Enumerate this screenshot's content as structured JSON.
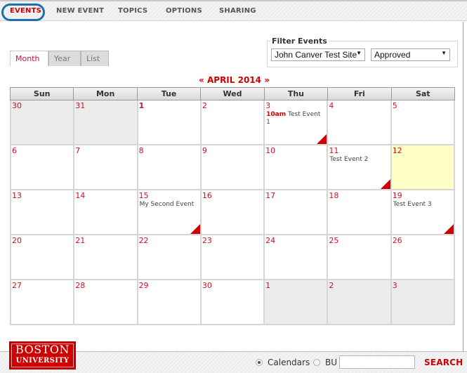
{
  "nav": {
    "items": [
      {
        "label": "EVENTS",
        "active": true
      },
      {
        "label": "NEW EVENT",
        "active": false
      },
      {
        "label": "TOPICS",
        "active": false
      },
      {
        "label": "OPTIONS",
        "active": false
      },
      {
        "label": "SHARING",
        "active": false
      }
    ],
    "accent": "#cc0000",
    "highlight_color": "#1b6fb0"
  },
  "filter": {
    "legend": "Filter Events",
    "site_select": {
      "value": "John Canver Test Site"
    },
    "status_select": {
      "value": "Approved"
    },
    "dropdown_icon": "triangle-down-icon"
  },
  "view_tabs": [
    {
      "label": "Month",
      "active": true
    },
    {
      "label": "Year",
      "active": false
    },
    {
      "label": "List",
      "active": false
    }
  ],
  "calendar": {
    "prev_label": "«",
    "month_label": "APRIL 2014",
    "next_label": "»",
    "weekdays": [
      "Sun",
      "Mon",
      "Tue",
      "Wed",
      "Thu",
      "Fri",
      "Sat"
    ],
    "weeks": [
      [
        {
          "day": "30",
          "other": true
        },
        {
          "day": "31",
          "other": true
        },
        {
          "day": "1",
          "bold": true
        },
        {
          "day": "2"
        },
        {
          "day": "3",
          "events": [
            {
              "time": "10am",
              "title": "Test Event 1"
            }
          ],
          "flag": true
        },
        {
          "day": "4"
        },
        {
          "day": "5"
        }
      ],
      [
        {
          "day": "6"
        },
        {
          "day": "7"
        },
        {
          "day": "8"
        },
        {
          "day": "9"
        },
        {
          "day": "10"
        },
        {
          "day": "11",
          "events": [
            {
              "time": "",
              "title": "Test Event 2"
            }
          ],
          "flag": true
        },
        {
          "day": "12",
          "today": true
        }
      ],
      [
        {
          "day": "13"
        },
        {
          "day": "14"
        },
        {
          "day": "15",
          "events": [
            {
              "time": "",
              "title": "My Second Event"
            }
          ],
          "flag": true
        },
        {
          "day": "16"
        },
        {
          "day": "17"
        },
        {
          "day": "18"
        },
        {
          "day": "19",
          "events": [
            {
              "time": "",
              "title": "Test Event 3"
            }
          ],
          "flag": true
        }
      ],
      [
        {
          "day": "20"
        },
        {
          "day": "21"
        },
        {
          "day": "22"
        },
        {
          "day": "23"
        },
        {
          "day": "24"
        },
        {
          "day": "25"
        },
        {
          "day": "26"
        }
      ],
      [
        {
          "day": "27"
        },
        {
          "day": "28"
        },
        {
          "day": "29"
        },
        {
          "day": "30"
        },
        {
          "day": "1",
          "other": true
        },
        {
          "day": "2",
          "other": true
        },
        {
          "day": "3",
          "other": true
        }
      ]
    ]
  },
  "footer": {
    "logo_line1": "BOSTON",
    "logo_line2": "UNIVERSITY",
    "radio_calendars": {
      "label": "Calendars",
      "checked": true
    },
    "radio_bu": {
      "label": "BU",
      "checked": false
    },
    "search_value": "",
    "search_button": "SEARCH"
  }
}
